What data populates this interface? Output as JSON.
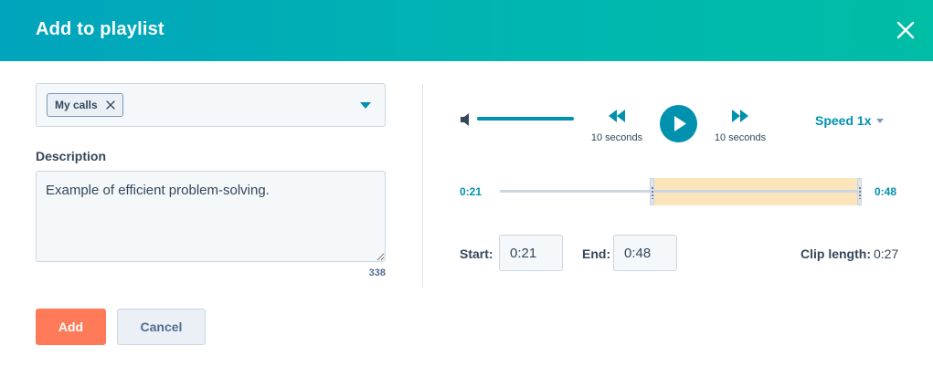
{
  "dialog": {
    "title": "Add to playlist",
    "close_icon": "close-icon"
  },
  "playlist": {
    "tags": [
      {
        "label": "My calls"
      }
    ],
    "remove_icon": "close-small-icon",
    "dropdown_icon": "caret-down-icon"
  },
  "description": {
    "label": "Description",
    "value": "Example of efficient problem-solving.",
    "char_count": "338"
  },
  "player": {
    "volume_icon": "volume-icon",
    "volume_level": 1.0,
    "rewind_label": "10 seconds",
    "forward_label": "10 seconds",
    "play_icon": "play-icon",
    "speed_label": "Speed 1x"
  },
  "timeline": {
    "start_time": "0:21",
    "end_time": "0:48"
  },
  "clip": {
    "start_label": "Start:",
    "start_value": "0:21",
    "end_label": "End:",
    "end_value": "0:48",
    "length_label": "Clip length:",
    "length_value": "0:27"
  },
  "footer": {
    "add_label": "Add",
    "cancel_label": "Cancel"
  },
  "colors": {
    "header_start": "#00a4bd",
    "header_end": "#00bda5",
    "accent": "#0091ae",
    "primary_button": "#ff7a59",
    "clip_highlight": "#fce4bb"
  }
}
